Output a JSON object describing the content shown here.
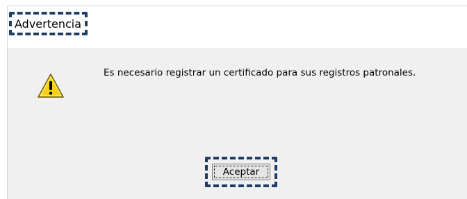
{
  "dialog": {
    "title": "Advertencia",
    "message": "Es necesario registrar un certificado para sus registros patronales.",
    "icon": "warning-icon",
    "accept_label": "Aceptar"
  },
  "colors": {
    "highlight_border": "#1f3e66",
    "dialog_background": "#f0f0f0",
    "titlebar_background": "#ffffff",
    "warning_fill": "#f7d117"
  }
}
